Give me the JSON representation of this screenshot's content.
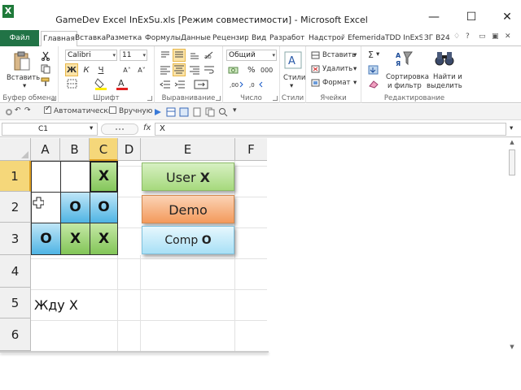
{
  "window": {
    "title": "GameDev Excel InExSu.xls  [Режим совместимости]  -  Microsoft Excel",
    "app_icon": "X",
    "minimize": "—",
    "maximize": "☐",
    "close": "✕"
  },
  "tabs": {
    "file": "Файл",
    "items": [
      "Главная",
      "Вставка",
      "Разметка с",
      "Формулы",
      "Данные",
      "Рецензир",
      "Вид",
      "Разработ",
      "Надстрой",
      "Efemerida",
      "TDD InExS",
      "ЗГ В24"
    ],
    "controls": [
      "♢",
      "?",
      "▭",
      "▣",
      "✕"
    ]
  },
  "ribbon": {
    "clipboard": {
      "label": "Буфер обмена",
      "paste": "Вставить"
    },
    "font": {
      "label": "Шрифт",
      "name": "Calibri",
      "size": "11",
      "bold": "Ж",
      "italic": "К",
      "underline": "Ч",
      "grow": "A˄",
      "shrink": "A˅"
    },
    "alignment": {
      "label": "Выравнивание"
    },
    "number": {
      "label": "Число",
      "format": "Общий",
      "percent": "%",
      "thousands": "000"
    },
    "styles": {
      "label": "Стили",
      "button": "Стили"
    },
    "cells": {
      "label": "Ячейки",
      "insert": "Вставить",
      "delete": "Удалить",
      "format": "Формат"
    },
    "editing": {
      "label": "Редактирование",
      "sort": "Сортировка\nи фильтр",
      "sort_line1": "Сортировка",
      "sort_line2": "и фильтр",
      "find_line1": "Найти и",
      "find_line2": "выделить",
      "sigma": "Σ"
    }
  },
  "quick_toolbar": {
    "auto_label": "Автоматически",
    "auto_checked": true,
    "manual_label": "Вручную",
    "manual_checked": false
  },
  "formula_bar": {
    "name_box": "C1",
    "fx": "fx",
    "content": "X"
  },
  "grid": {
    "columns": [
      "A",
      "B",
      "C",
      "D",
      "E",
      "F"
    ],
    "selected_column": "C",
    "rows": [
      "1",
      "2",
      "3",
      "4",
      "5",
      "6"
    ],
    "selected_row": "1",
    "board": {
      "a1": "",
      "b1": "",
      "c1": "X",
      "a2": "",
      "b2": "O",
      "c2": "O",
      "a3": "O",
      "b3": "X",
      "c3": "X"
    },
    "status_text": "Жду X"
  },
  "shapes": {
    "user_prefix": "User ",
    "user_mark": "X",
    "demo": "Demo",
    "comp_prefix": "Comp ",
    "comp_mark": "O"
  },
  "colors": {
    "file_tab": "#217346",
    "selected_header": "#f5d77a",
    "green_cell": "#82c558",
    "blue_cell": "#4fb4e4",
    "demo_shape": "#f39a5c"
  }
}
